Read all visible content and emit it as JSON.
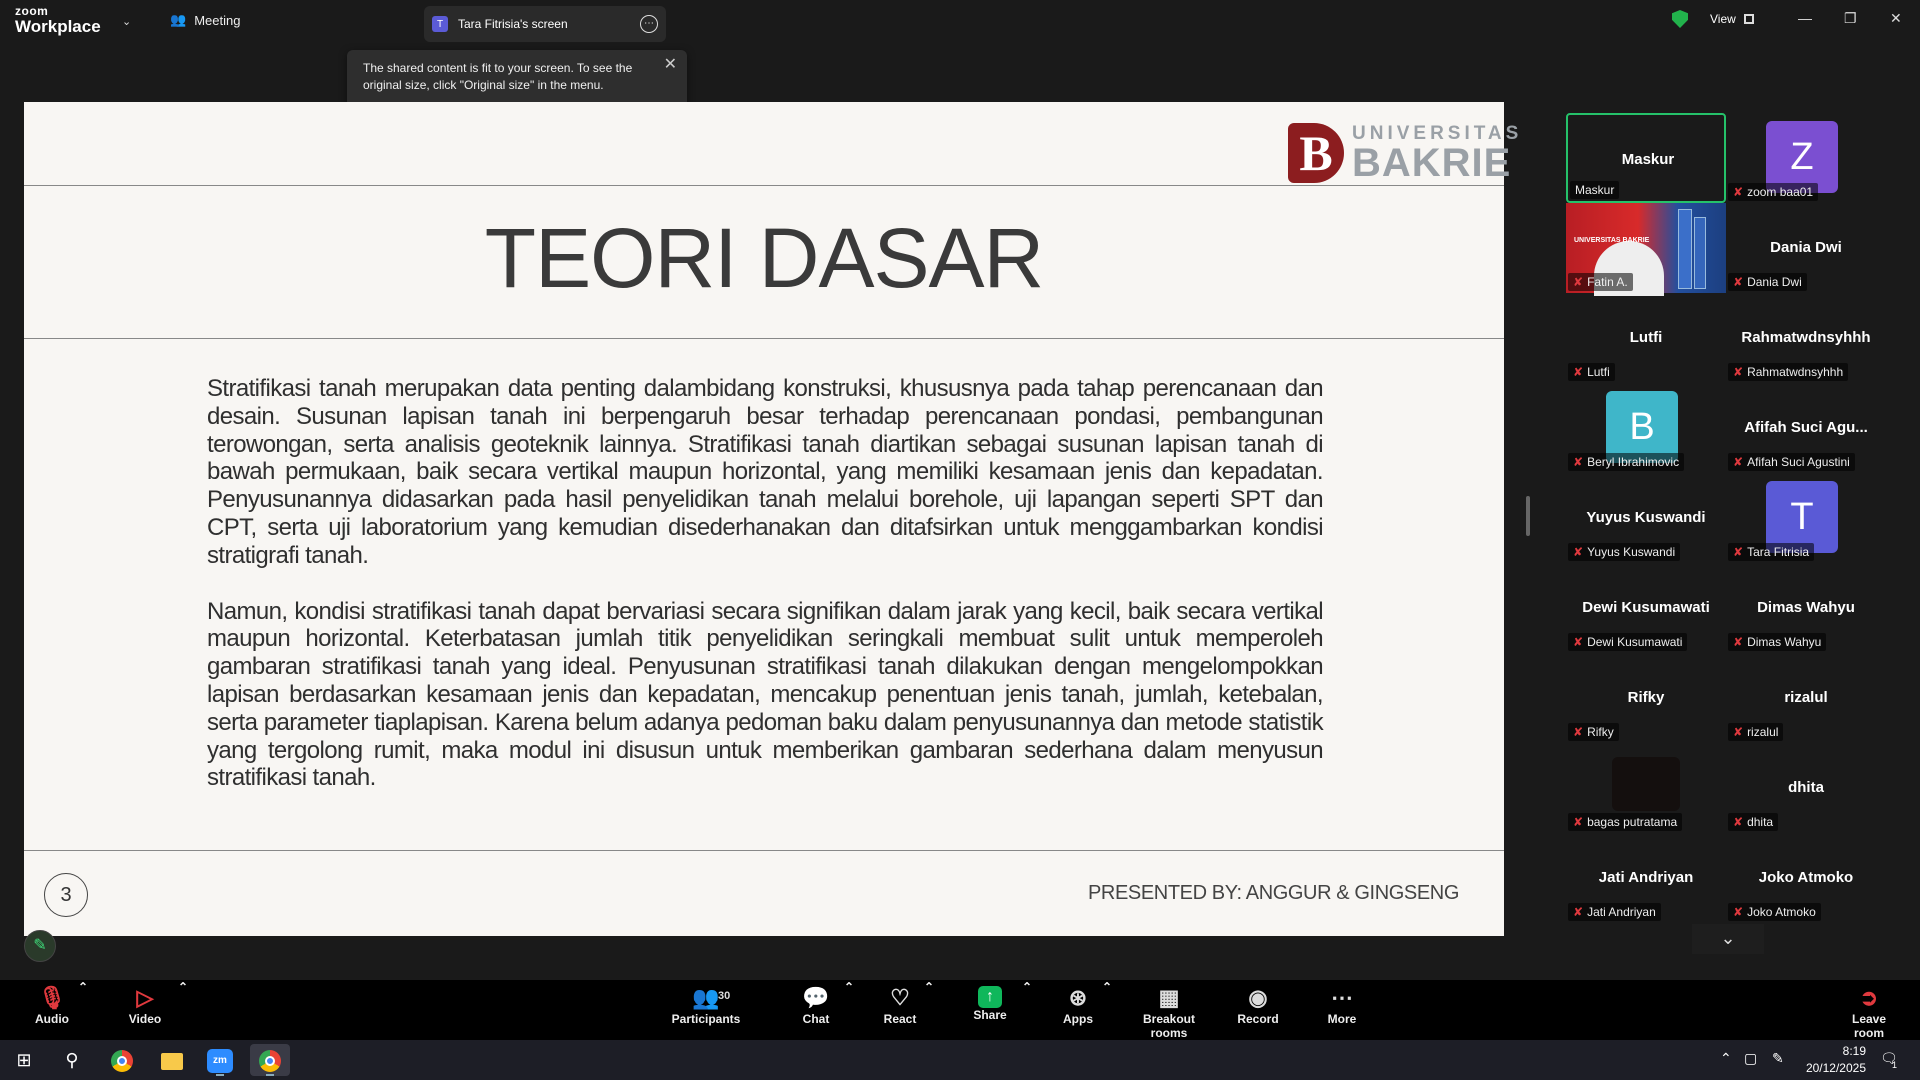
{
  "titlebar": {
    "brand_top": "zoom",
    "brand_bottom": "Workplace",
    "meeting_label": "Meeting",
    "share_tab_initial": "T",
    "share_tab_label": "Tara Fitrisia's screen",
    "view_label": "View"
  },
  "tooltip": {
    "text": "The shared content is fit to your screen. To see the original size, click \"Original size\" in the menu."
  },
  "slide": {
    "title": "TEORI DASAR",
    "logo_line1": "UNIVERSITAS",
    "logo_line2": "BAKRIE",
    "logo_mark": "B",
    "paragraph1": "Stratifikasi tanah merupakan data penting dalambidang konstruksi, khususnya pada tahap perencanaan dan desain. Susunan lapisan tanah ini berpengaruh besar terhadap perencanaan pondasi, pembangunan terowongan, serta analisis geoteknik lainnya. Stratifikasi tanah diartikan sebagai susunan lapisan tanah di bawah permukaan, baik secara vertikal maupun horizontal, yang memiliki kesamaan jenis dan kepadatan. Penyusunannya didasarkan pada hasil penyelidikan tanah melalui borehole, uji lapangan seperti SPT dan CPT, serta uji laboratorium yang kemudian disederhanakan dan ditafsirkan untuk menggambarkan kondisi stratigrafi tanah.",
    "paragraph2": "Namun, kondisi stratifikasi tanah dapat bervariasi secara signifikan dalam jarak yang kecil, baik secara vertikal maupun horizontal. Keterbatasan jumlah titik penyelidikan seringkali membuat sulit untuk memperoleh gambaran stratifikasi tanah yang ideal. Penyusunan stratifikasi tanah dilakukan dengan mengelompokkan lapisan berdasarkan kesamaan jenis dan kepadatan, mencakup penentuan jenis tanah, jumlah, ketebalan, serta parameter tiaplapisan. Karena belum adanya pedoman baku dalam penyusunannya dan metode statistik yang tergolong rumit, maka modul ini disusun untuk memberikan gambaran sederhana dalam menyusun stratifikasi tanah.",
    "page_number": "3",
    "presented_by": "PRESENTED BY: ANGGUR & GINGSENG"
  },
  "participants": [
    {
      "display": "Maskur",
      "label": "Maskur",
      "kind": "name",
      "active": true
    },
    {
      "display": "Z",
      "label": "zoom baa01",
      "kind": "avatar",
      "color": "#7b4fd1"
    },
    {
      "display": "",
      "label": "Fatin A.",
      "kind": "video"
    },
    {
      "display": "Dania Dwi",
      "label": "Dania Dwi",
      "kind": "name"
    },
    {
      "display": "Lutfi",
      "label": "Lutfi",
      "kind": "name"
    },
    {
      "display": "Rahmatwdnsyhhh",
      "label": "Rahmatwdnsyhhh",
      "kind": "name"
    },
    {
      "display": "B",
      "label": "Beryl Ibrahimovic",
      "kind": "avatar",
      "color": "#3fb6c9"
    },
    {
      "display": "Afifah Suci Agu...",
      "label": "Afifah Suci Agustini",
      "kind": "name"
    },
    {
      "display": "Yuyus Kuswandi",
      "label": "Yuyus Kuswandi",
      "kind": "name"
    },
    {
      "display": "T",
      "label": "Tara Fitrisia",
      "kind": "avatar",
      "color": "#5a5ad6"
    },
    {
      "display": "Dewi Kusumawati",
      "label": "Dewi Kusumawati",
      "kind": "name"
    },
    {
      "display": "Dimas Wahyu",
      "label": "Dimas Wahyu",
      "kind": "name"
    },
    {
      "display": "Rifky",
      "label": "Rifky",
      "kind": "name"
    },
    {
      "display": "rizalul",
      "label": "rizalul",
      "kind": "name"
    },
    {
      "display": "",
      "label": "bagas putratama",
      "kind": "dark"
    },
    {
      "display": "dhita",
      "label": "dhita",
      "kind": "name"
    },
    {
      "display": "Jati Andriyan",
      "label": "Jati Andriyan",
      "kind": "name"
    },
    {
      "display": "Joko Atmoko",
      "label": "Joko Atmoko",
      "kind": "name"
    }
  ],
  "video_thumb_text": "UNIVERSITAS BAKRIE",
  "toolbar": {
    "audio": "Audio",
    "video": "Video",
    "participants": "Participants",
    "participants_count": "30",
    "chat": "Chat",
    "react": "React",
    "share": "Share",
    "apps": "Apps",
    "breakout": "Breakout rooms",
    "record": "Record",
    "more": "More",
    "leave": "Leave room"
  },
  "taskbar": {
    "time": "8:19",
    "date": "20/12/2025",
    "zoom_badge": "zm",
    "notif": "1"
  },
  "colors": {
    "accent_green": "#25c26a",
    "mic_muted": "#e0393e",
    "slide_bg": "#f8f6f3",
    "brand_red": "#8c1d1f"
  }
}
